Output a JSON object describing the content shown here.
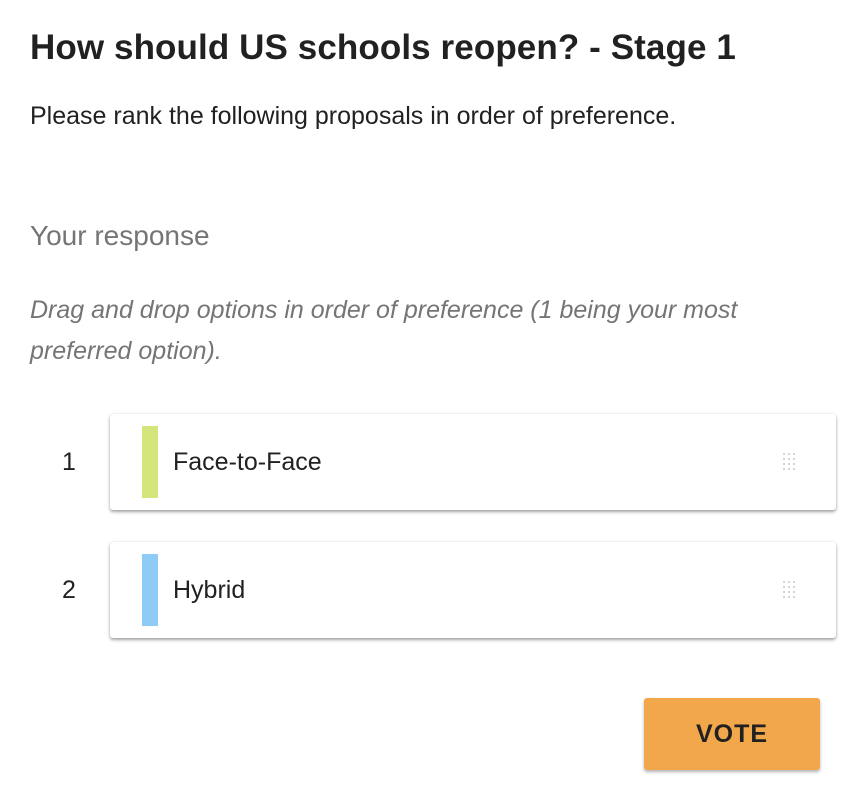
{
  "poll": {
    "title": "How should US schools reopen? - Stage 1",
    "instructions": "Please rank the following proposals in order of preference."
  },
  "response": {
    "heading": "Your response",
    "hint": "Drag and drop options in order of preference (1 being your most preferred option)."
  },
  "options": [
    {
      "rank": "1",
      "label": "Face-to-Face",
      "color": "#d4e57c",
      "icon": "drag-handle-icon"
    },
    {
      "rank": "2",
      "label": "Hybrid",
      "color": "#8ecbf7",
      "icon": "drag-handle-icon"
    }
  ],
  "actions": {
    "vote_label": "VOTE",
    "vote_color": "#f2a74a"
  }
}
